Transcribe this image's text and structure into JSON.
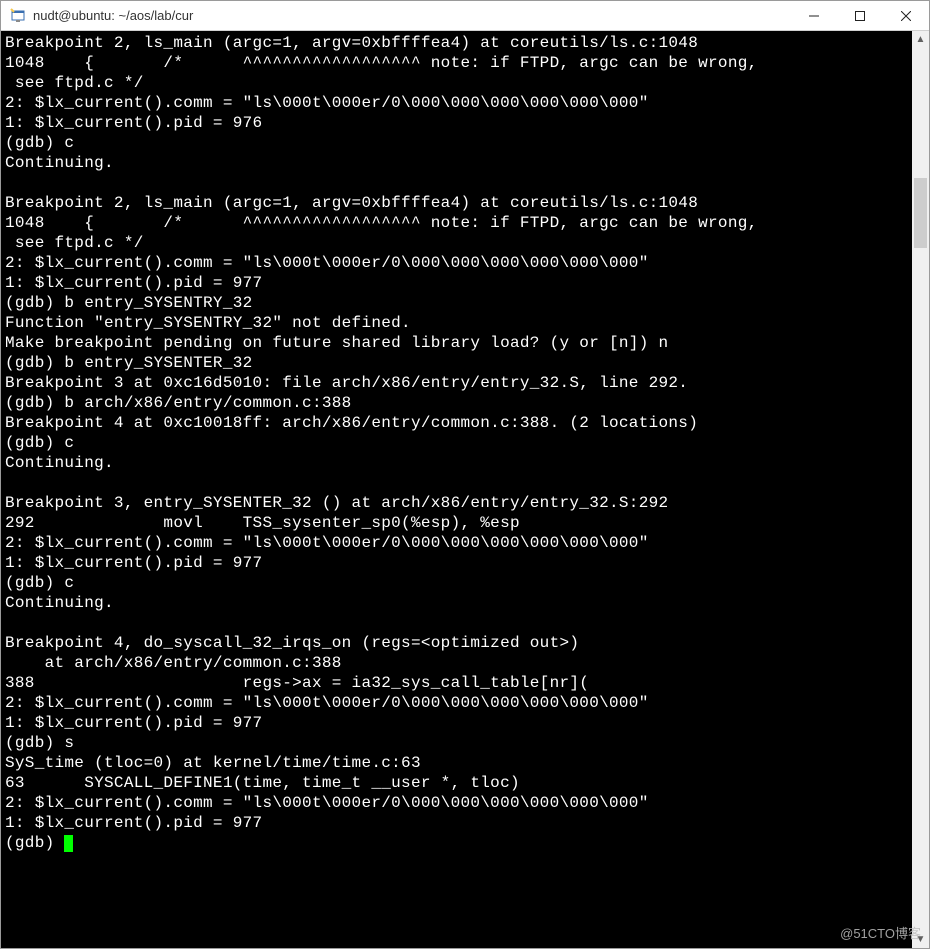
{
  "window": {
    "title": "nudt@ubuntu: ~/aos/lab/cur"
  },
  "terminal": {
    "lines": [
      "Breakpoint 2, ls_main (argc=1, argv=0xbffffea4) at coreutils/ls.c:1048",
      "1048    {       /*      ^^^^^^^^^^^^^^^^^^ note: if FTPD, argc can be wrong,",
      " see ftpd.c */",
      "2: $lx_current().comm = \"ls\\000t\\000er/0\\000\\000\\000\\000\\000\\000\"",
      "1: $lx_current().pid = 976",
      "(gdb) c",
      "Continuing.",
      "",
      "Breakpoint 2, ls_main (argc=1, argv=0xbffffea4) at coreutils/ls.c:1048",
      "1048    {       /*      ^^^^^^^^^^^^^^^^^^ note: if FTPD, argc can be wrong,",
      " see ftpd.c */",
      "2: $lx_current().comm = \"ls\\000t\\000er/0\\000\\000\\000\\000\\000\\000\"",
      "1: $lx_current().pid = 977",
      "(gdb) b entry_SYSENTRY_32",
      "Function \"entry_SYSENTRY_32\" not defined.",
      "Make breakpoint pending on future shared library load? (y or [n]) n",
      "(gdb) b entry_SYSENTER_32",
      "Breakpoint 3 at 0xc16d5010: file arch/x86/entry/entry_32.S, line 292.",
      "(gdb) b arch/x86/entry/common.c:388",
      "Breakpoint 4 at 0xc10018ff: arch/x86/entry/common.c:388. (2 locations)",
      "(gdb) c",
      "Continuing.",
      "",
      "Breakpoint 3, entry_SYSENTER_32 () at arch/x86/entry/entry_32.S:292",
      "292             movl    TSS_sysenter_sp0(%esp), %esp",
      "2: $lx_current().comm = \"ls\\000t\\000er/0\\000\\000\\000\\000\\000\\000\"",
      "1: $lx_current().pid = 977",
      "(gdb) c",
      "Continuing.",
      "",
      "Breakpoint 4, do_syscall_32_irqs_on (regs=<optimized out>)",
      "    at arch/x86/entry/common.c:388",
      "388                     regs->ax = ia32_sys_call_table[nr](",
      "2: $lx_current().comm = \"ls\\000t\\000er/0\\000\\000\\000\\000\\000\\000\"",
      "1: $lx_current().pid = 977",
      "(gdb) s",
      "SyS_time (tloc=0) at kernel/time/time.c:63",
      "63      SYSCALL_DEFINE1(time, time_t __user *, tloc)",
      "2: $lx_current().comm = \"ls\\000t\\000er/0\\000\\000\\000\\000\\000\\000\"",
      "1: $lx_current().pid = 977",
      "(gdb) "
    ]
  },
  "watermark": "@51CTO博客"
}
